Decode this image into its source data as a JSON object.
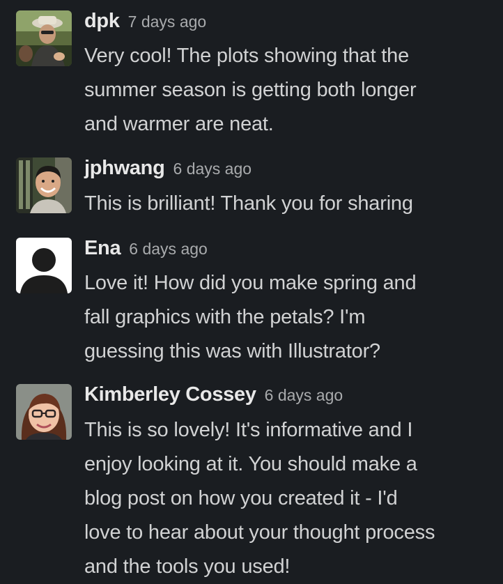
{
  "messages": [
    {
      "author": "dpk",
      "time": "7 days ago",
      "lines": [
        "Very cool! The plots showing that the",
        "summer season is getting both longer",
        "and warmer are neat."
      ],
      "avatar_icon": "profile-photo-icon"
    },
    {
      "author": "jphwang",
      "time": "6 days ago",
      "lines": [
        "This is brilliant! Thank you for sharing"
      ],
      "avatar_icon": "profile-photo-icon"
    },
    {
      "author": "Ena",
      "time": "6 days ago",
      "lines": [
        "Love it! How did you make spring and",
        "fall graphics with the petals? I'm",
        "guessing this was with Illustrator?"
      ],
      "avatar_icon": "default-user-icon"
    },
    {
      "author": "Kimberley Cossey",
      "time": "6 days ago",
      "lines": [
        "This is so lovely! It's informative and I",
        "enjoy looking at it. You should make a",
        "blog post on how you created it - I'd",
        "love to hear about your thought process",
        "and the tools you used!"
      ],
      "avatar_icon": "profile-photo-icon"
    }
  ],
  "colors": {
    "background": "#1a1d21",
    "text": "#d1d2d3",
    "name": "#e8e8e8",
    "timestamp": "#a9abad"
  }
}
